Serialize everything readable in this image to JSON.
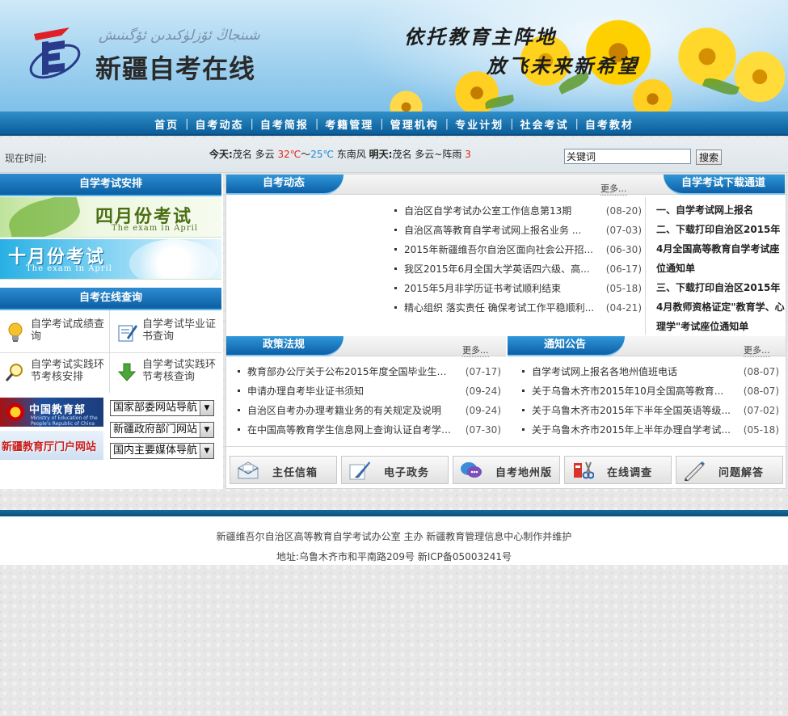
{
  "header": {
    "site_name": "新疆自考在线",
    "site_name_uyghur": "شىنجاڭ ئۆزلۈكىدىن ئۆگىنىش",
    "slogan_line1": "依托教育主阵地",
    "slogan_line2": "放飞未来新希望"
  },
  "nav": {
    "items": [
      "首页",
      "自考动态",
      "自考简报",
      "考籍管理",
      "管理机构",
      "专业计划",
      "社会考试",
      "自考教材"
    ],
    "separator": "|"
  },
  "status": {
    "now_time_label": "现在时间:",
    "today_label": "今天:",
    "today_weather": "茂名 多云",
    "temp_high": "32℃",
    "temp_sep": "～",
    "temp_low": "25℃",
    "wind": "东南风",
    "tomorrow_label": "明天:",
    "tomorrow_weather": "茂名 多云~阵雨",
    "tomorrow_temp_fragment": "3",
    "search_value": "关键词",
    "search_button": "搜索"
  },
  "left": {
    "exam_schedule_title": "自学考试安排",
    "april_banner_title": "四月份考试",
    "april_banner_sub": "The exam in April",
    "october_banner_title": "十月份考试",
    "october_banner_sub": "The exam in April",
    "online_query_title": "自考在线查询",
    "queries": [
      {
        "label": "自学考试成绩查询",
        "icon": "lightbulb-icon"
      },
      {
        "label": "自学考试毕业证书查询",
        "icon": "pen-certificate-icon"
      },
      {
        "label": "自学考试实践环节考核安排",
        "icon": "magnifier-icon"
      },
      {
        "label": "自学考试实践环节考核查询",
        "icon": "download-arrow-icon"
      }
    ],
    "moe_logo_text": "中国教育部",
    "moe_logo_sub": "Ministry of Education of the People's Republic of China",
    "xj_edu_logo_text": "新疆教育厅门户网站",
    "selects": [
      "国家部委网站导航",
      "新疆政府部门网站",
      "国内主要媒体导航"
    ]
  },
  "news": {
    "title": "自考动态",
    "more": "更多...",
    "items": [
      {
        "title": "自治区自学考试办公室工作信息第13期",
        "date": "(08-20)"
      },
      {
        "title": "自治区高等教育自学考试网上报名业务 ...",
        "date": "(07-03)"
      },
      {
        "title": "2015年新疆维吾尔自治区面向社会公开招...",
        "date": "(06-30)"
      },
      {
        "title": "我区2015年6月全国大学英语四六级、高...",
        "date": "(06-17)"
      },
      {
        "title": "2015年5月非学历证书考试顺利结束",
        "date": "(05-18)"
      },
      {
        "title": "精心组织  落实责任  确保考试工作平稳顺利...",
        "date": "(04-21)"
      }
    ]
  },
  "download": {
    "title": "自学考试下载通道",
    "items": [
      "一、自学考试网上报名",
      "二、下载打印自治区2015年4月全国高等教育自学考试座位通知单",
      "三、下载打印自治区2015年4月教师资格证定\"教育学、心理学\"考试座位通知单"
    ]
  },
  "policy": {
    "title": "政策法规",
    "more": "更多...",
    "items": [
      {
        "title": "教育部办公厅关于公布2015年度全国毕业生就...",
        "date": "(07-17)"
      },
      {
        "title": "申请办理自考毕业证书须知",
        "date": "(09-24)"
      },
      {
        "title": "自治区自考办办理考籍业务的有关规定及说明",
        "date": "(09-24)"
      },
      {
        "title": "在中国高等教育学生信息网上查询认证自考学历的...",
        "date": "(07-30)"
      }
    ]
  },
  "notice": {
    "title": "通知公告",
    "more": "更多...",
    "items": [
      {
        "title": "自学考试网上报名各地州值班电话",
        "date": "(08-07)"
      },
      {
        "title": "关于乌鲁木齐市2015年10月全国高等教育...",
        "date": "(08-07)"
      },
      {
        "title": "关于乌鲁木齐市2015年下半年全国英语等级...",
        "date": "(07-02)"
      },
      {
        "title": "关于乌鲁木齐市2015年上半年办理自学考试...",
        "date": "(05-18)"
      }
    ]
  },
  "bottom_buttons": [
    {
      "label": "主任信箱",
      "icon": "mailbox-icon"
    },
    {
      "label": "电子政务",
      "icon": "quill-pen-icon"
    },
    {
      "label": "自考地州版",
      "icon": "chat-bubbles-icon"
    },
    {
      "label": "在线调查",
      "icon": "survey-scissors-icon"
    },
    {
      "label": "问题解答",
      "icon": "pencil-question-icon"
    }
  ],
  "footer": {
    "line1": "新疆维吾尔自治区高等教育自学考试办公室 主办  新疆教育管理信息中心制作并维护",
    "line2": "地址:乌鲁木齐市和平南路209号  新ICP备05003241号"
  },
  "colors": {
    "nav_blue": "#0b5d98",
    "tab_blue": "#0d5fa6",
    "temp_high": "#e1261c",
    "temp_low": "#1c8ad6"
  }
}
